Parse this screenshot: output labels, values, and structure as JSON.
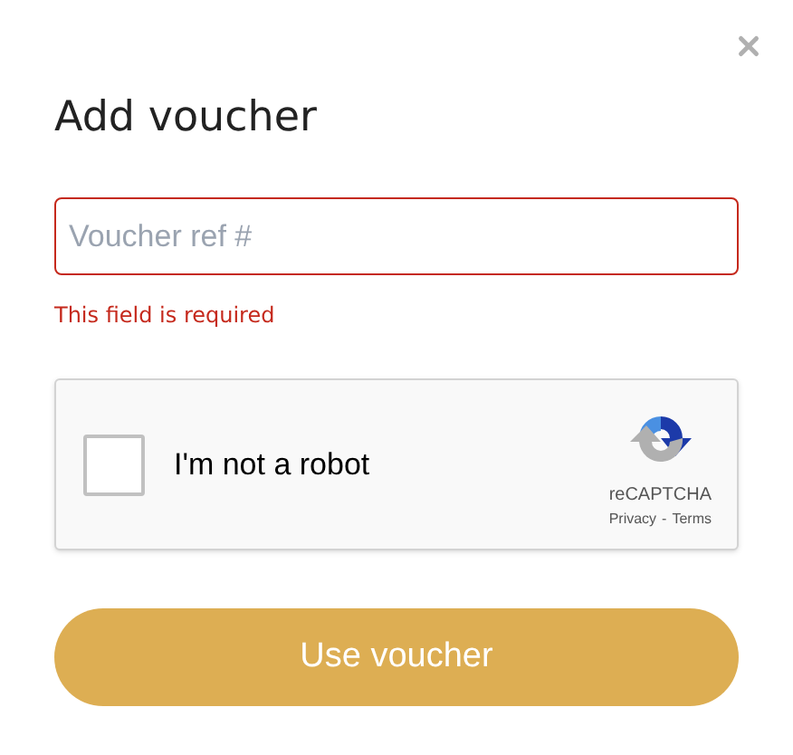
{
  "dialog": {
    "title": "Add voucher"
  },
  "voucher_field": {
    "placeholder": "Voucher ref #",
    "invalid": true,
    "error": "This field is required"
  },
  "captcha": {
    "label": "I'm not a robot",
    "checked": false,
    "brand": "reCAPTCHA",
    "links": [
      "Privacy",
      "Terms"
    ],
    "separator": "-"
  },
  "submit_button": {
    "label": "Use voucher"
  }
}
